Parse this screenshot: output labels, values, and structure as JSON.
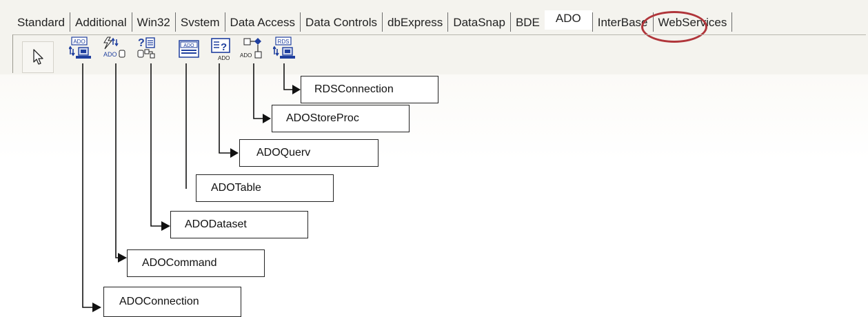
{
  "tabs": [
    {
      "label": "Standard"
    },
    {
      "label": "Additional"
    },
    {
      "label": "Win32"
    },
    {
      "label": "Svstem"
    },
    {
      "label": "Data Access"
    },
    {
      "label": "Data Controls"
    },
    {
      "label": "dbExpress"
    },
    {
      "label": "DataSnap"
    },
    {
      "label": "BDE"
    },
    {
      "label": "ADO",
      "active": true
    },
    {
      "label": "InterBase"
    },
    {
      "label": "WebServices"
    }
  ],
  "toolbar": {
    "icons": [
      {
        "name": "pointer-icon"
      },
      {
        "name": "adoconnection-icon",
        "text": "ADO"
      },
      {
        "name": "adocommand-icon",
        "text": "ADO"
      },
      {
        "name": "adodataset-icon"
      },
      {
        "name": "adotable-icon",
        "text": "ADO"
      },
      {
        "name": "adoquery-icon",
        "text": "ADO"
      },
      {
        "name": "adostoredproc-icon",
        "text": "ADO"
      },
      {
        "name": "rdsconnection-icon",
        "text": "RDS"
      }
    ]
  },
  "labels": {
    "rds": "RDSConnection",
    "storeproc": "ADOStoreProc",
    "query": "ADOQuerv",
    "table": "ADOTable",
    "dataset": "ADODataset",
    "command": "ADOCommand",
    "connection": "ADOConnection"
  },
  "colors": {
    "highlight": "#b0353a",
    "icon_blue": "#1f3f9e"
  }
}
